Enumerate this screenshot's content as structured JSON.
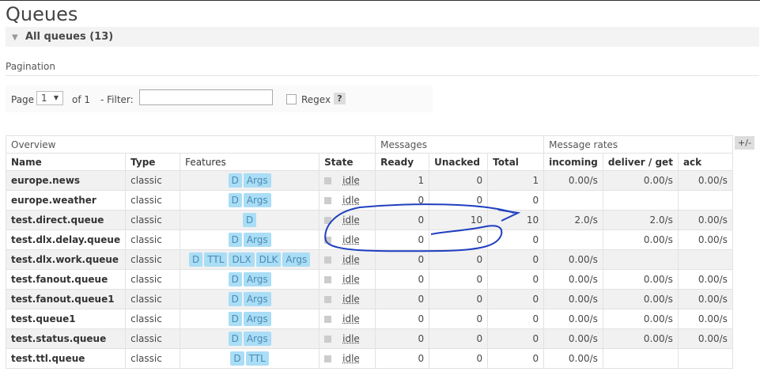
{
  "page": {
    "title": "Queues"
  },
  "section": {
    "label": "All queues (13)"
  },
  "pagination": {
    "label": "Pagination",
    "page_label": "Page",
    "page_value": "1",
    "of_text": "of 1",
    "filter_label": "- Filter:",
    "filter_value": "",
    "regex_label": "Regex",
    "help": "?"
  },
  "table": {
    "group_headers": [
      "Overview",
      "Messages",
      "Message rates"
    ],
    "toggle_label": "+/-",
    "columns": [
      "Name",
      "Type",
      "Features",
      "State",
      "Ready",
      "Unacked",
      "Total",
      "incoming",
      "deliver / get",
      "ack"
    ],
    "rows": [
      {
        "name": "europe.news",
        "type": "classic",
        "features": [
          "D",
          "Args"
        ],
        "state": "idle",
        "ready": "1",
        "unacked": "0",
        "total": "1",
        "incoming": "0.00/s",
        "deliver": "0.00/s",
        "ack": "0.00/s"
      },
      {
        "name": "europe.weather",
        "type": "classic",
        "features": [
          "D",
          "Args"
        ],
        "state": "idle",
        "ready": "0",
        "unacked": "0",
        "total": "0",
        "incoming": "",
        "deliver": "",
        "ack": ""
      },
      {
        "name": "test.direct.queue",
        "type": "classic",
        "features": [
          "D"
        ],
        "state": "idle",
        "ready": "0",
        "unacked": "10",
        "total": "10",
        "incoming": "2.0/s",
        "deliver": "2.0/s",
        "ack": "0.00/s"
      },
      {
        "name": "test.dlx.delay.queue",
        "type": "classic",
        "features": [
          "D",
          "Args"
        ],
        "state": "idle",
        "ready": "0",
        "unacked": "0",
        "total": "0",
        "incoming": "",
        "deliver": "0.00/s",
        "ack": "0.00/s"
      },
      {
        "name": "test.dlx.work.queue",
        "type": "classic",
        "features": [
          "D",
          "TTL",
          "DLX",
          "DLK",
          "Args"
        ],
        "state": "idle",
        "ready": "0",
        "unacked": "0",
        "total": "0",
        "incoming": "0.00/s",
        "deliver": "",
        "ack": ""
      },
      {
        "name": "test.fanout.queue",
        "type": "classic",
        "features": [
          "D",
          "Args"
        ],
        "state": "idle",
        "ready": "0",
        "unacked": "0",
        "total": "0",
        "incoming": "0.00/s",
        "deliver": "0.00/s",
        "ack": "0.00/s"
      },
      {
        "name": "test.fanout.queue1",
        "type": "classic",
        "features": [
          "D",
          "Args"
        ],
        "state": "idle",
        "ready": "0",
        "unacked": "0",
        "total": "0",
        "incoming": "0.00/s",
        "deliver": "0.00/s",
        "ack": "0.00/s"
      },
      {
        "name": "test.queue1",
        "type": "classic",
        "features": [
          "D",
          "Args"
        ],
        "state": "idle",
        "ready": "0",
        "unacked": "0",
        "total": "0",
        "incoming": "0.00/s",
        "deliver": "0.00/s",
        "ack": "0.00/s"
      },
      {
        "name": "test.status.queue",
        "type": "classic",
        "features": [
          "D",
          "Args"
        ],
        "state": "idle",
        "ready": "0",
        "unacked": "0",
        "total": "0",
        "incoming": "0.00/s",
        "deliver": "0.00/s",
        "ack": "0.00/s"
      },
      {
        "name": "test.ttl.queue",
        "type": "classic",
        "features": [
          "D",
          "TTL"
        ],
        "state": "idle",
        "ready": "0",
        "unacked": "0",
        "total": "0",
        "incoming": "0.00/s",
        "deliver": "",
        "ack": ""
      }
    ]
  },
  "colors": {
    "tag_bg": "#aaddf6",
    "tag_fg": "#4a8bb3",
    "ink": "#1f3fbf"
  }
}
